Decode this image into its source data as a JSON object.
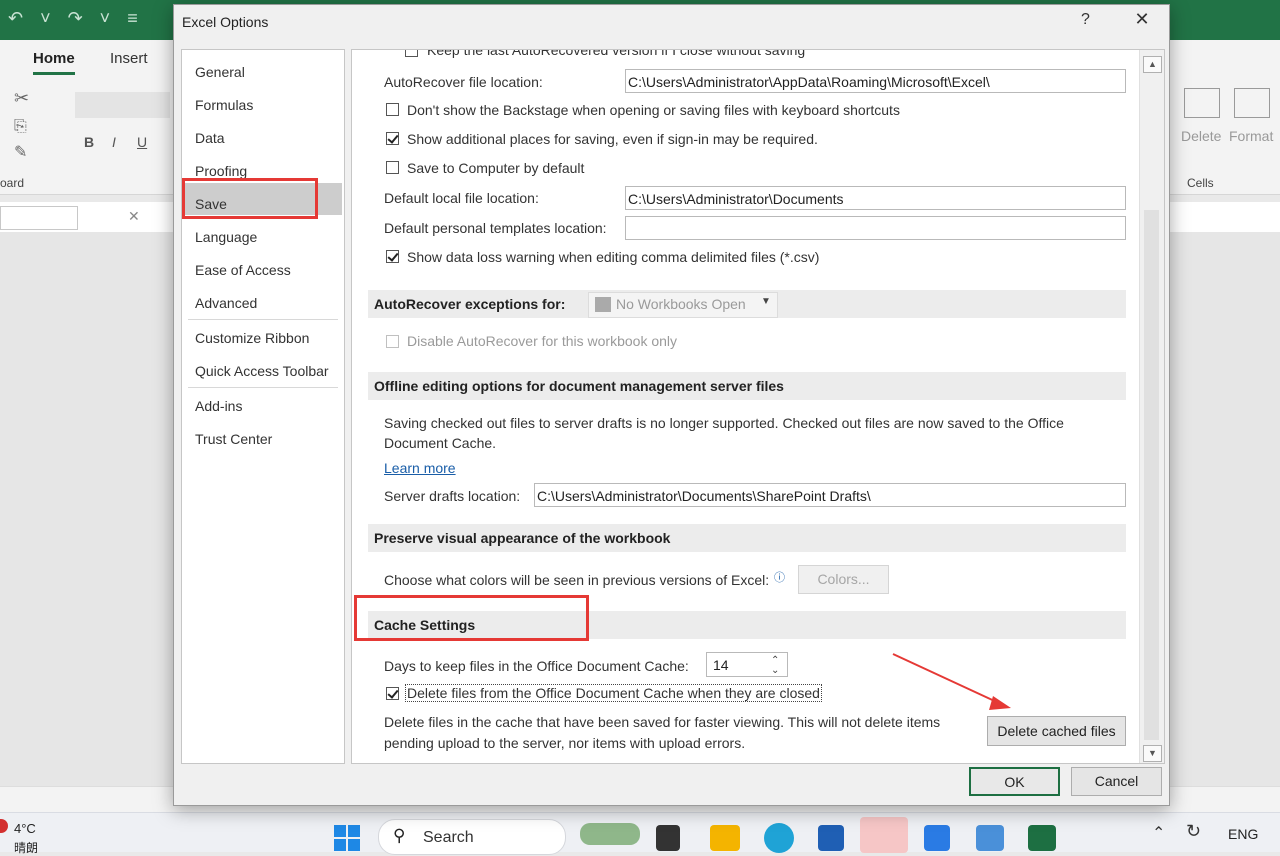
{
  "excel": {
    "tabs": [
      "Home",
      "Insert"
    ],
    "ribbon_right": {
      "delete": "Delete",
      "format": "Format",
      "group_cells": "Cells"
    },
    "ribbon_left": {
      "clipboard_label": "oard",
      "font_b": "B",
      "font_i": "I",
      "font_u": "U"
    }
  },
  "dialog": {
    "title": "Excel Options",
    "help": "?",
    "close": "✕",
    "nav": [
      "General",
      "Formulas",
      "Data",
      "Proofing",
      "Save",
      "Language",
      "Ease of Access",
      "Advanced",
      "Customize Ribbon",
      "Quick Access Toolbar",
      "Add-ins",
      "Trust Center"
    ],
    "selected_nav": "Save",
    "content": {
      "top_cut_text": "Keep the last AutoRecovered version if I close without saving",
      "autorecover_location_label": "AutoRecover file location:",
      "autorecover_location_value": "C:\\Users\\Administrator\\AppData\\Roaming\\Microsoft\\Excel\\",
      "dont_show_backstage": "Don't show the Backstage when opening or saving files with keyboard shortcuts",
      "show_additional_places": "Show additional places for saving, even if sign-in may be required.",
      "save_to_computer": "Save to Computer by default",
      "default_local_label": "Default local file location:",
      "default_local_value": "C:\\Users\\Administrator\\Documents",
      "default_templates_label": "Default personal templates location:",
      "default_templates_value": "",
      "show_data_loss": "Show data loss warning when editing comma delimited files (*.csv)",
      "autorecover_exceptions_header": "AutoRecover exceptions for:",
      "no_workbooks": "No Workbooks Open",
      "disable_autorecover": "Disable AutoRecover for this workbook only",
      "offline_header": "Offline editing options for document management server files",
      "offline_desc_1": "Saving checked out files to server drafts is no longer supported. Checked out files are now saved to the Office",
      "offline_desc_2": "Document Cache.",
      "learn_more": "Learn more",
      "server_drafts_label": "Server drafts location:",
      "server_drafts_value": "C:\\Users\\Administrator\\Documents\\SharePoint Drafts\\",
      "preserve_header": "Preserve visual appearance of the workbook",
      "choose_colors": "Choose what colors will be seen in previous versions of Excel:",
      "colors_button": "Colors...",
      "cache_header": "Cache Settings",
      "days_label": "Days to keep files in the Office Document Cache:",
      "days_value": "14",
      "delete_files_closed": "Delete files from the Office Document Cache when they are closed",
      "cache_desc_1": "Delete files in the cache that have been saved for faster viewing. This will not delete items",
      "cache_desc_2": "pending upload to the server, nor items with upload errors.",
      "delete_cached_button": "Delete cached files"
    },
    "ok": "OK",
    "cancel": "Cancel"
  },
  "taskbar": {
    "weather_temp": "4°C",
    "weather_desc": "晴朗",
    "search": "Search",
    "lang": "ENG"
  },
  "annotation_color": "#e53935"
}
